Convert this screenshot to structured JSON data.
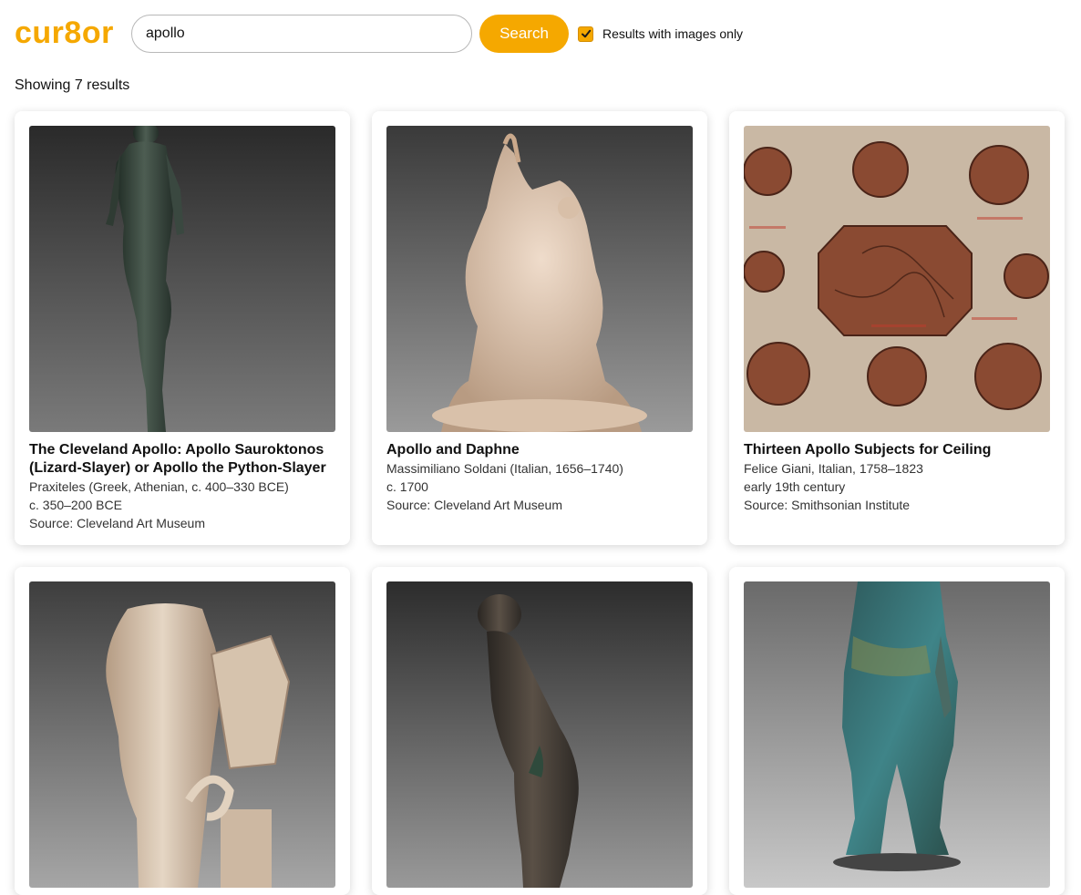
{
  "header": {
    "logo": "cur8or",
    "search": {
      "value": "apollo",
      "placeholder": ""
    },
    "search_button": "Search",
    "filter": {
      "label": "Results with images only",
      "checked": true
    }
  },
  "results": {
    "count_text": "Showing 7 results",
    "items": [
      {
        "title": "The Cleveland Apollo: Apollo Sauroktonos (Lizard-Slayer) or Apollo the Python-Slayer",
        "artist": "Praxiteles (Greek, Athenian, c. 400–330 BCE)",
        "date": "c. 350–200 BCE",
        "source": "Source: Cleveland Art Museum",
        "image_alt": "bronze statue of Apollo"
      },
      {
        "title": "Apollo and Daphne",
        "artist": "Massimiliano Soldani (Italian, 1656–1740)",
        "date": "c. 1700",
        "source": "Source: Cleveland Art Museum",
        "image_alt": "terracotta sculpture of Apollo and Daphne"
      },
      {
        "title": "Thirteen Apollo Subjects for Ceiling",
        "artist": "Felice Giani, Italian, 1758–1823",
        "date": "early 19th century",
        "source": "Source: Smithsonian Institute",
        "image_alt": "ink drawing of circular ceiling medallions"
      },
      {
        "title": "",
        "artist": "",
        "date": "",
        "source": "",
        "image_alt": "marble torso of Apollo with lyre and swan"
      },
      {
        "title": "",
        "artist": "",
        "date": "",
        "source": "",
        "image_alt": "dark bronze leaning figure"
      },
      {
        "title": "",
        "artist": "",
        "date": "",
        "source": "",
        "image_alt": "green patinated bronze standing figure"
      }
    ]
  },
  "colors": {
    "accent": "#f5a800",
    "image_dark_bg": "#3a3a3a",
    "image_paper_bg": "#c9b8a4"
  }
}
